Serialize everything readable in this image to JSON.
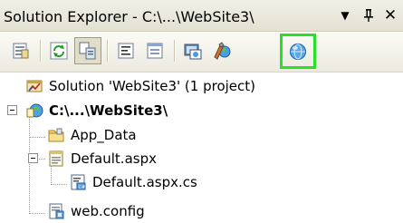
{
  "title_bar": {
    "title": "Solution Explorer - C:\\...\\WebSite3\\",
    "buttons": [
      {
        "name": "window-position-dropdown",
        "glyph": "▼"
      },
      {
        "name": "auto-hide-pin",
        "glyph": "ꟸ"
      },
      {
        "name": "close",
        "glyph": "✕"
      }
    ]
  },
  "toolbar": {
    "buttons": [
      {
        "name": "properties-icon"
      },
      {
        "name": "refresh-icon"
      },
      {
        "name": "nest-related-files-icon",
        "pressed": true
      },
      {
        "name": "view-code-icon"
      },
      {
        "name": "view-designer-icon"
      },
      {
        "name": "copy-website-icon"
      },
      {
        "name": "aspnet-configuration-icon"
      },
      {
        "name": "unknown-round-icon",
        "highlighted": true
      }
    ],
    "highlight_color": "#27e027"
  },
  "tree": {
    "solution": "Solution 'WebSite3' (1 project)",
    "project": "C:\\...\\WebSite3\\",
    "items": [
      {
        "label": "App_Data",
        "icon": "folder-icon"
      },
      {
        "label": "Default.aspx",
        "icon": "aspx-page-icon",
        "expanded": true
      },
      {
        "label": "Default.aspx.cs",
        "icon": "code-file-icon"
      },
      {
        "label": "web.config",
        "icon": "config-file-icon"
      }
    ]
  }
}
